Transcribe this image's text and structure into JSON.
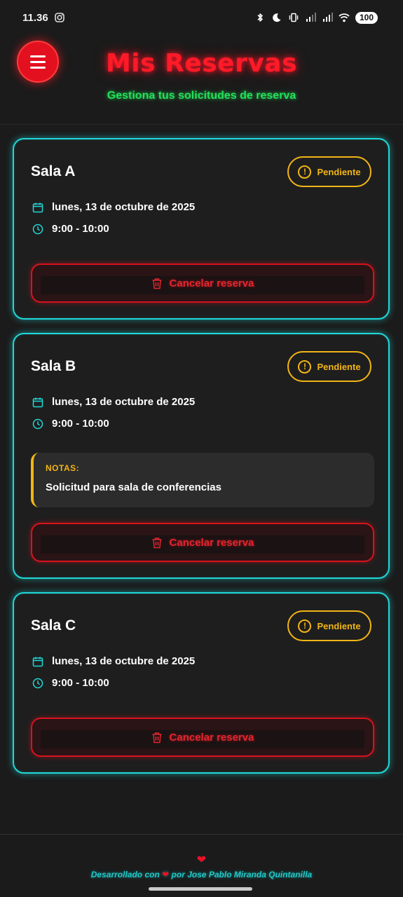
{
  "status_bar": {
    "time": "11.36",
    "battery": "100"
  },
  "header": {
    "title": "Mis Reservas",
    "subtitle": "Gestiona tus solicitudes de reserva"
  },
  "reservations": [
    {
      "room": "Sala A",
      "status": "Pendiente",
      "date": "lunes, 13 de octubre de 2025",
      "time": "9:00 - 10:00",
      "cancel_label": "Cancelar reserva"
    },
    {
      "room": "Sala B",
      "status": "Pendiente",
      "date": "lunes, 13 de octubre de 2025",
      "time": "9:00 - 10:00",
      "notes_label": "NOTAS:",
      "notes": "Solicitud para sala de conferencias",
      "cancel_label": "Cancelar reserva"
    },
    {
      "room": "Sala C",
      "status": "Pendiente",
      "date": "lunes, 13 de octubre de 2025",
      "time": "9:00 - 10:00",
      "cancel_label": "Cancelar reserva"
    }
  ],
  "footer": {
    "text_before": "Desarrollado con",
    "text_after": "por Jose Pablo Miranda Quintanilla"
  },
  "colors": {
    "accent_red": "#e3101f",
    "accent_cyan": "#20d8d8",
    "accent_green": "#22e05a",
    "pending_yellow": "#f2b516",
    "background": "#1b1b1b"
  }
}
